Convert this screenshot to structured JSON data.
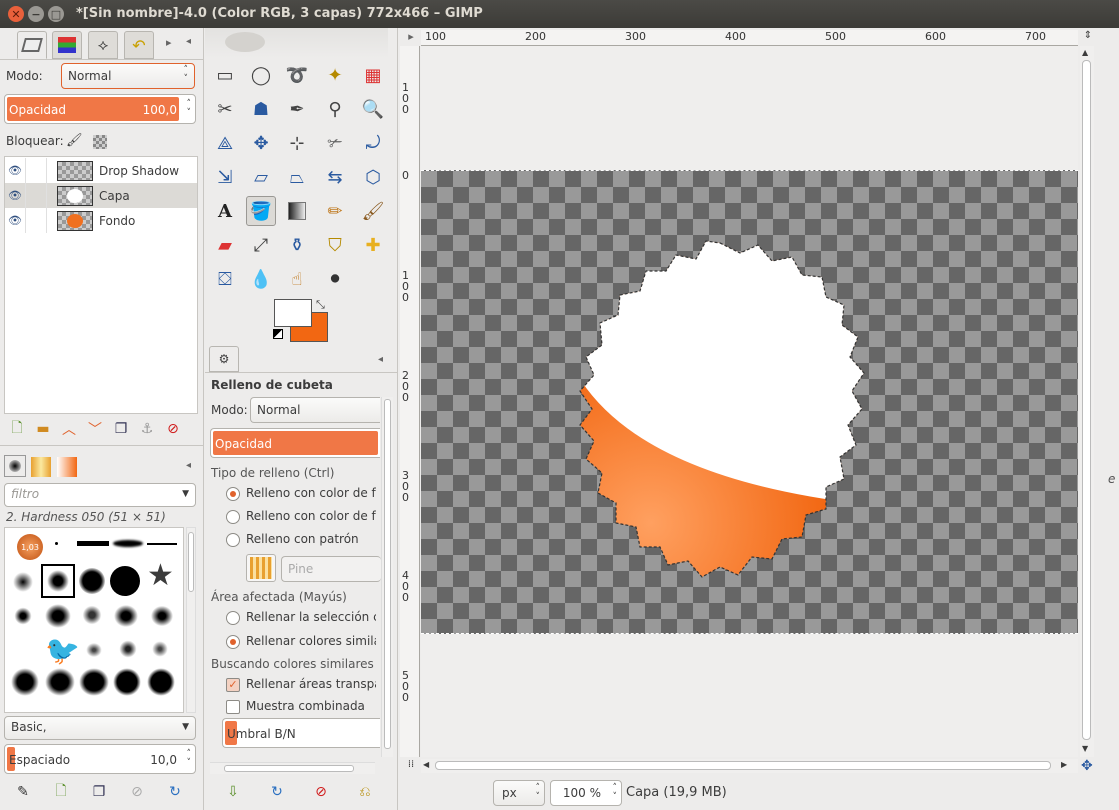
{
  "window": {
    "title": "*[Sin nombre]-4.0 (Color RGB, 3 capas) 772x466 – GIMP"
  },
  "layers_panel": {
    "mode_label": "Modo:",
    "mode_value": "Normal",
    "opacity_label": "Opacidad",
    "opacity_value": "100,0",
    "lock_label": "Bloquear:",
    "layers": [
      {
        "name": "Drop Shadow"
      },
      {
        "name": "Capa"
      },
      {
        "name": "Fondo"
      }
    ]
  },
  "brushes_panel": {
    "filter_placeholder": "filtro",
    "brush_name": "2. Hardness 050 (51 × 51)",
    "first_brush_label": "1,03",
    "preset_value": "Basic,",
    "spacing_label": "Espaciado",
    "spacing_value": "10,0"
  },
  "tool_options": {
    "title": "Relleno de cubeta",
    "mode_label": "Modo:",
    "mode_value": "Normal",
    "opacity_label": "Opacidad",
    "fill_type_label": "Tipo de relleno (Ctrl)",
    "fill_fg": "Relleno con color de fre",
    "fill_bg": "Relleno con color de for",
    "fill_pattern": "Relleno con patrón",
    "pattern_name": "Pine",
    "affected_area_label": "Área afectada (Mayús)",
    "fill_selection": "Rellenar la selección co",
    "fill_similar": "Rellenar colores similare",
    "finding_similar_label": "Buscando colores similares",
    "fill_transparent": "Rellenar áreas transpare",
    "sample_merged": "Muestra combinada",
    "threshold_label": "Umbral B/N"
  },
  "ruler": {
    "h_ticks": [
      "100",
      "200",
      "300",
      "400",
      "500",
      "600",
      "700"
    ],
    "v_ticks": [
      "100",
      "0",
      "100",
      "200",
      "300",
      "400",
      "500"
    ]
  },
  "status": {
    "unit": "px",
    "zoom": "100 %",
    "info": "Capa (19,9 MB)"
  },
  "colors": {
    "fg": "#ffffff",
    "bg": "#f26712",
    "accent": "#f07746"
  }
}
